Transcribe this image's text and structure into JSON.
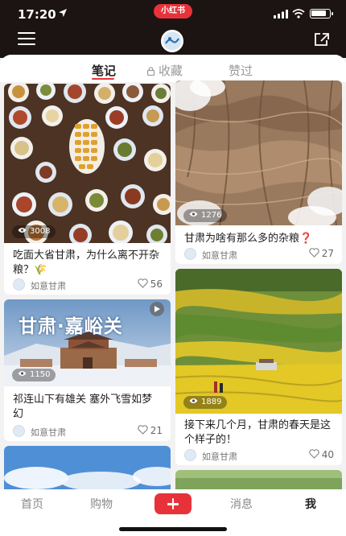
{
  "status": {
    "time": "17:20",
    "app_badge": "小红书",
    "battery_level": 0.85
  },
  "tabs": [
    {
      "label": "笔记"
    },
    {
      "label": "收藏"
    },
    {
      "label": "赞过"
    }
  ],
  "notes": [
    {
      "title": "吃面大省甘肃，为什么离不开杂粮？🌾",
      "views": "3008",
      "author": "如意甘肃",
      "likes": "56",
      "image": "banquet-dishes"
    },
    {
      "title": "甘肃为啥有那么多的杂粮❓",
      "views": "1276",
      "author": "如意甘肃",
      "likes": "27",
      "image": "aerial-loess-terraces"
    },
    {
      "title": "祁连山下有雄关 塞外飞雪如梦幻",
      "views": "1150",
      "author": "如意甘肃",
      "likes": "21",
      "image": "jiayuguan-snow",
      "overlay_text": "甘肃·嘉峪关"
    },
    {
      "title": "接下来几个月，甘肃的春天是这个样子的！",
      "views": "1889",
      "author": "如意甘肃",
      "likes": "40",
      "image": "rapeseed-fields"
    },
    {
      "title": "",
      "views": "",
      "author": "",
      "likes": "",
      "image": "blue-sky-clouds"
    },
    {
      "title": "",
      "views": "",
      "author": "",
      "likes": "",
      "image": "green-grassland"
    }
  ],
  "bottom_nav": [
    {
      "label": "首页"
    },
    {
      "label": "购物"
    },
    {
      "label": "+"
    },
    {
      "label": "消息"
    },
    {
      "label": "我"
    }
  ],
  "icons": {
    "menu": "menu-icon",
    "share": "share-icon",
    "lock": "lock-icon",
    "eye": "eye-icon",
    "heart": "heart-icon",
    "plus": "plus-icon"
  },
  "colors": {
    "accent": "#e8323a",
    "header": "#1c1413",
    "background": "#f2f2f2"
  }
}
